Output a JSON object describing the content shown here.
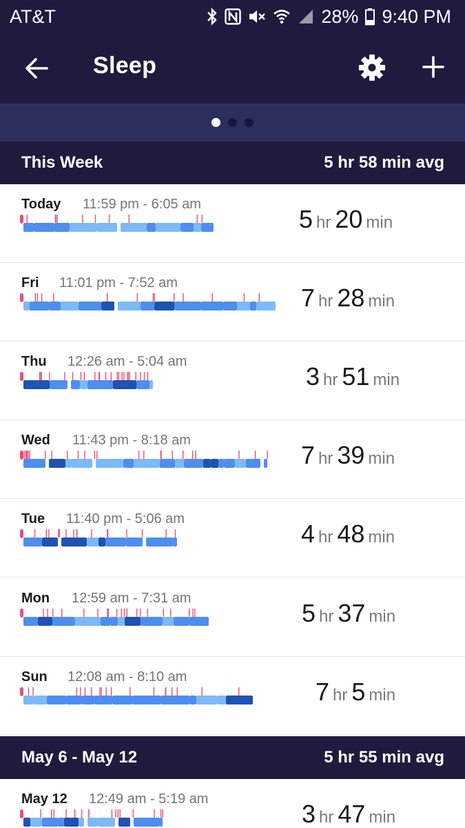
{
  "status_bar": {
    "carrier": "AT&T",
    "battery": "28%",
    "time": "9:40 PM",
    "icons": [
      "bluetooth-icon",
      "nfc-icon",
      "mute-icon",
      "wifi-icon",
      "signal-icon",
      "battery-icon"
    ]
  },
  "app_bar": {
    "title": "Sleep",
    "icons": [
      "back-arrow-icon",
      "gear-icon",
      "plus-icon"
    ]
  },
  "pager": {
    "pages": 3,
    "active": 0
  },
  "colors": {
    "header_bg": "#1f1b3e",
    "pager_bg": "#2c2e5e",
    "awake": "#ee4c78",
    "light": "#4d8ef0",
    "deep": "#1f52b3",
    "rem": "#7db9f7"
  },
  "sections": [
    {
      "title": "This Week",
      "avg": "5 hr 58 min avg",
      "entries": [
        {
          "day": "Today",
          "range": "11:59 pm - 6:05 am",
          "hr": "5",
          "min": "20"
        },
        {
          "day": "Fri",
          "range": "11:01 pm - 7:52 am",
          "hr": "7",
          "min": "28"
        },
        {
          "day": "Thu",
          "range": "12:26 am - 5:04 am",
          "hr": "3",
          "min": "51"
        },
        {
          "day": "Wed",
          "range": "11:43 pm - 8:18 am",
          "hr": "7",
          "min": "39"
        },
        {
          "day": "Tue",
          "range": "11:40 pm - 5:06 am",
          "hr": "4",
          "min": "48"
        },
        {
          "day": "Mon",
          "range": "12:59 am - 7:31 am",
          "hr": "5",
          "min": "37"
        },
        {
          "day": "Sun",
          "range": "12:08 am - 8:10 am",
          "hr": "7",
          "min": "5"
        }
      ]
    },
    {
      "title": "May 6 - May 12",
      "avg": "5 hr 55 min avg",
      "entries": [
        {
          "day": "May 12",
          "range": "12:49 am - 5:19 am",
          "hr": "3",
          "min": "47"
        }
      ]
    }
  ],
  "units": {
    "hr": "hr",
    "min": "min"
  }
}
